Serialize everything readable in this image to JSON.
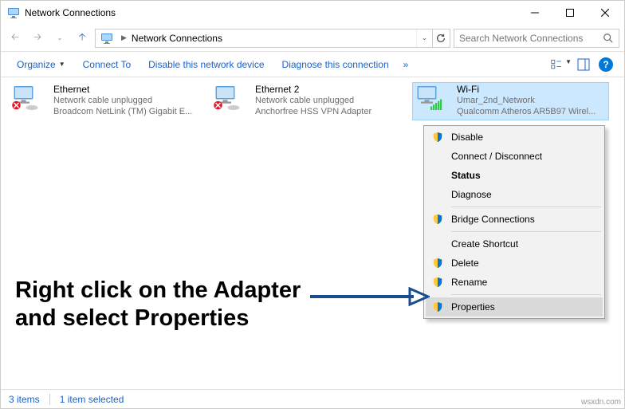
{
  "title": "Network Connections",
  "breadcrumb": "Network Connections",
  "search_placeholder": "Search Network Connections",
  "toolbar": {
    "organize": "Organize",
    "connect": "Connect To",
    "disable": "Disable this network device",
    "diagnose": "Diagnose this connection"
  },
  "adapters": [
    {
      "name": "Ethernet",
      "status": "Network cable unplugged",
      "device": "Broadcom NetLink (TM) Gigabit E..."
    },
    {
      "name": "Ethernet 2",
      "status": "Network cable unplugged",
      "device": "Anchorfree HSS VPN Adapter"
    },
    {
      "name": "Wi-Fi",
      "status": "Umar_2nd_Network",
      "device": "Qualcomm Atheros AR5B97 Wirel..."
    }
  ],
  "context_menu": {
    "disable": "Disable",
    "connect": "Connect / Disconnect",
    "status": "Status",
    "diagnose": "Diagnose",
    "bridge": "Bridge Connections",
    "shortcut": "Create Shortcut",
    "delete": "Delete",
    "rename": "Rename",
    "properties": "Properties"
  },
  "annotation": "Right click on the Adapter and select Properties",
  "statusbar": {
    "items": "3 items",
    "selected": "1 item selected"
  },
  "watermark": "wsxdn.com"
}
